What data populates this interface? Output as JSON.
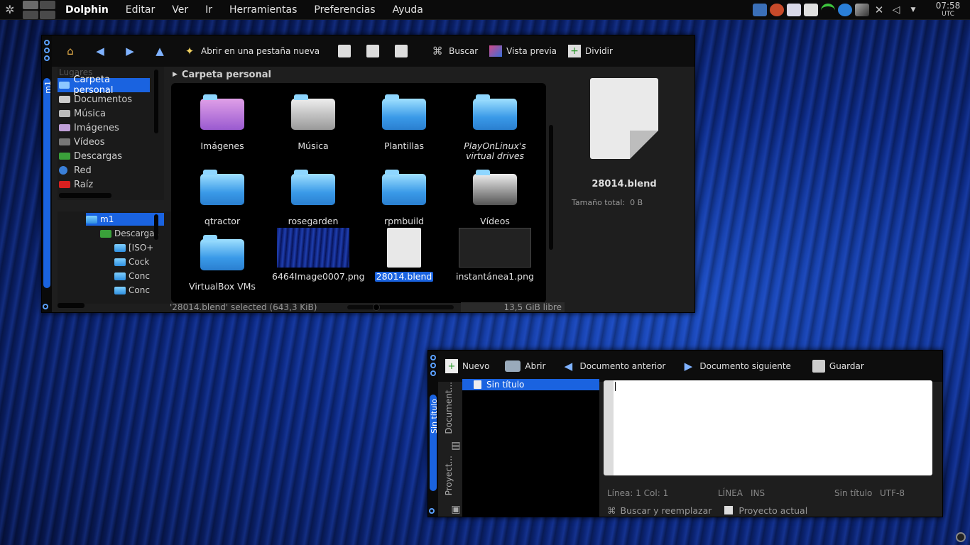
{
  "panel": {
    "app_name": "Dolphin",
    "menu": [
      "Editar",
      "Ver",
      "Ir",
      "Herramientas",
      "Preferencias",
      "Ayuda"
    ],
    "clock_time": "07:58",
    "clock_zone": "UTC"
  },
  "dolphin": {
    "window_tab": "m1",
    "toolbar": {
      "new_tab": "Abrir en una pestaña nueva",
      "search": "Buscar",
      "preview": "Vista previa",
      "split": "Dividir"
    },
    "places_header": "Lugares",
    "places": [
      "Carpeta personal",
      "Documentos",
      "Música",
      "Imágenes",
      "Vídeos",
      "Descargas",
      "Red",
      "Raíz"
    ],
    "tree": {
      "root": "m1",
      "child": "Descargas",
      "sub": [
        "[ISO+",
        "Cock",
        "Conc",
        "Conc"
      ]
    },
    "breadcrumb": "Carpeta personal",
    "files": [
      {
        "name": "Imágenes"
      },
      {
        "name": "Música"
      },
      {
        "name": "Plantillas"
      },
      {
        "name": "PlayOnLinux's virtual drives"
      },
      {
        "name": "qtractor"
      },
      {
        "name": "rosegarden"
      },
      {
        "name": "rpmbuild"
      },
      {
        "name": "Vídeos"
      },
      {
        "name": "VirtualBox VMs"
      },
      {
        "name": "6464Image0007.png"
      },
      {
        "name": "28014.blend"
      },
      {
        "name": "instantánea1.png"
      }
    ],
    "preview_name": "28014.blend",
    "preview_size_label": "Tamaño total:",
    "preview_size_value": "0 B",
    "status_text": "'28014.blend' selected (643,3 KiB)",
    "free_space": "13,5 GiB libre"
  },
  "kate": {
    "window_title": "Sin título",
    "toolbar": {
      "new": "Nuevo",
      "open": "Abrir",
      "prev": "Documento anterior",
      "next": "Documento siguiente",
      "save": "Guardar"
    },
    "side_documents": "Document...",
    "side_project": "Proyect...",
    "doc_item": "Sin título",
    "status": {
      "position": "Línea: 1 Col: 1",
      "mode": "LÍNEA",
      "ins": "INS",
      "name": "Sin título",
      "encoding": "UTF-8"
    },
    "bottom": {
      "search": "Buscar y reemplazar",
      "project": "Proyecto actual"
    }
  }
}
